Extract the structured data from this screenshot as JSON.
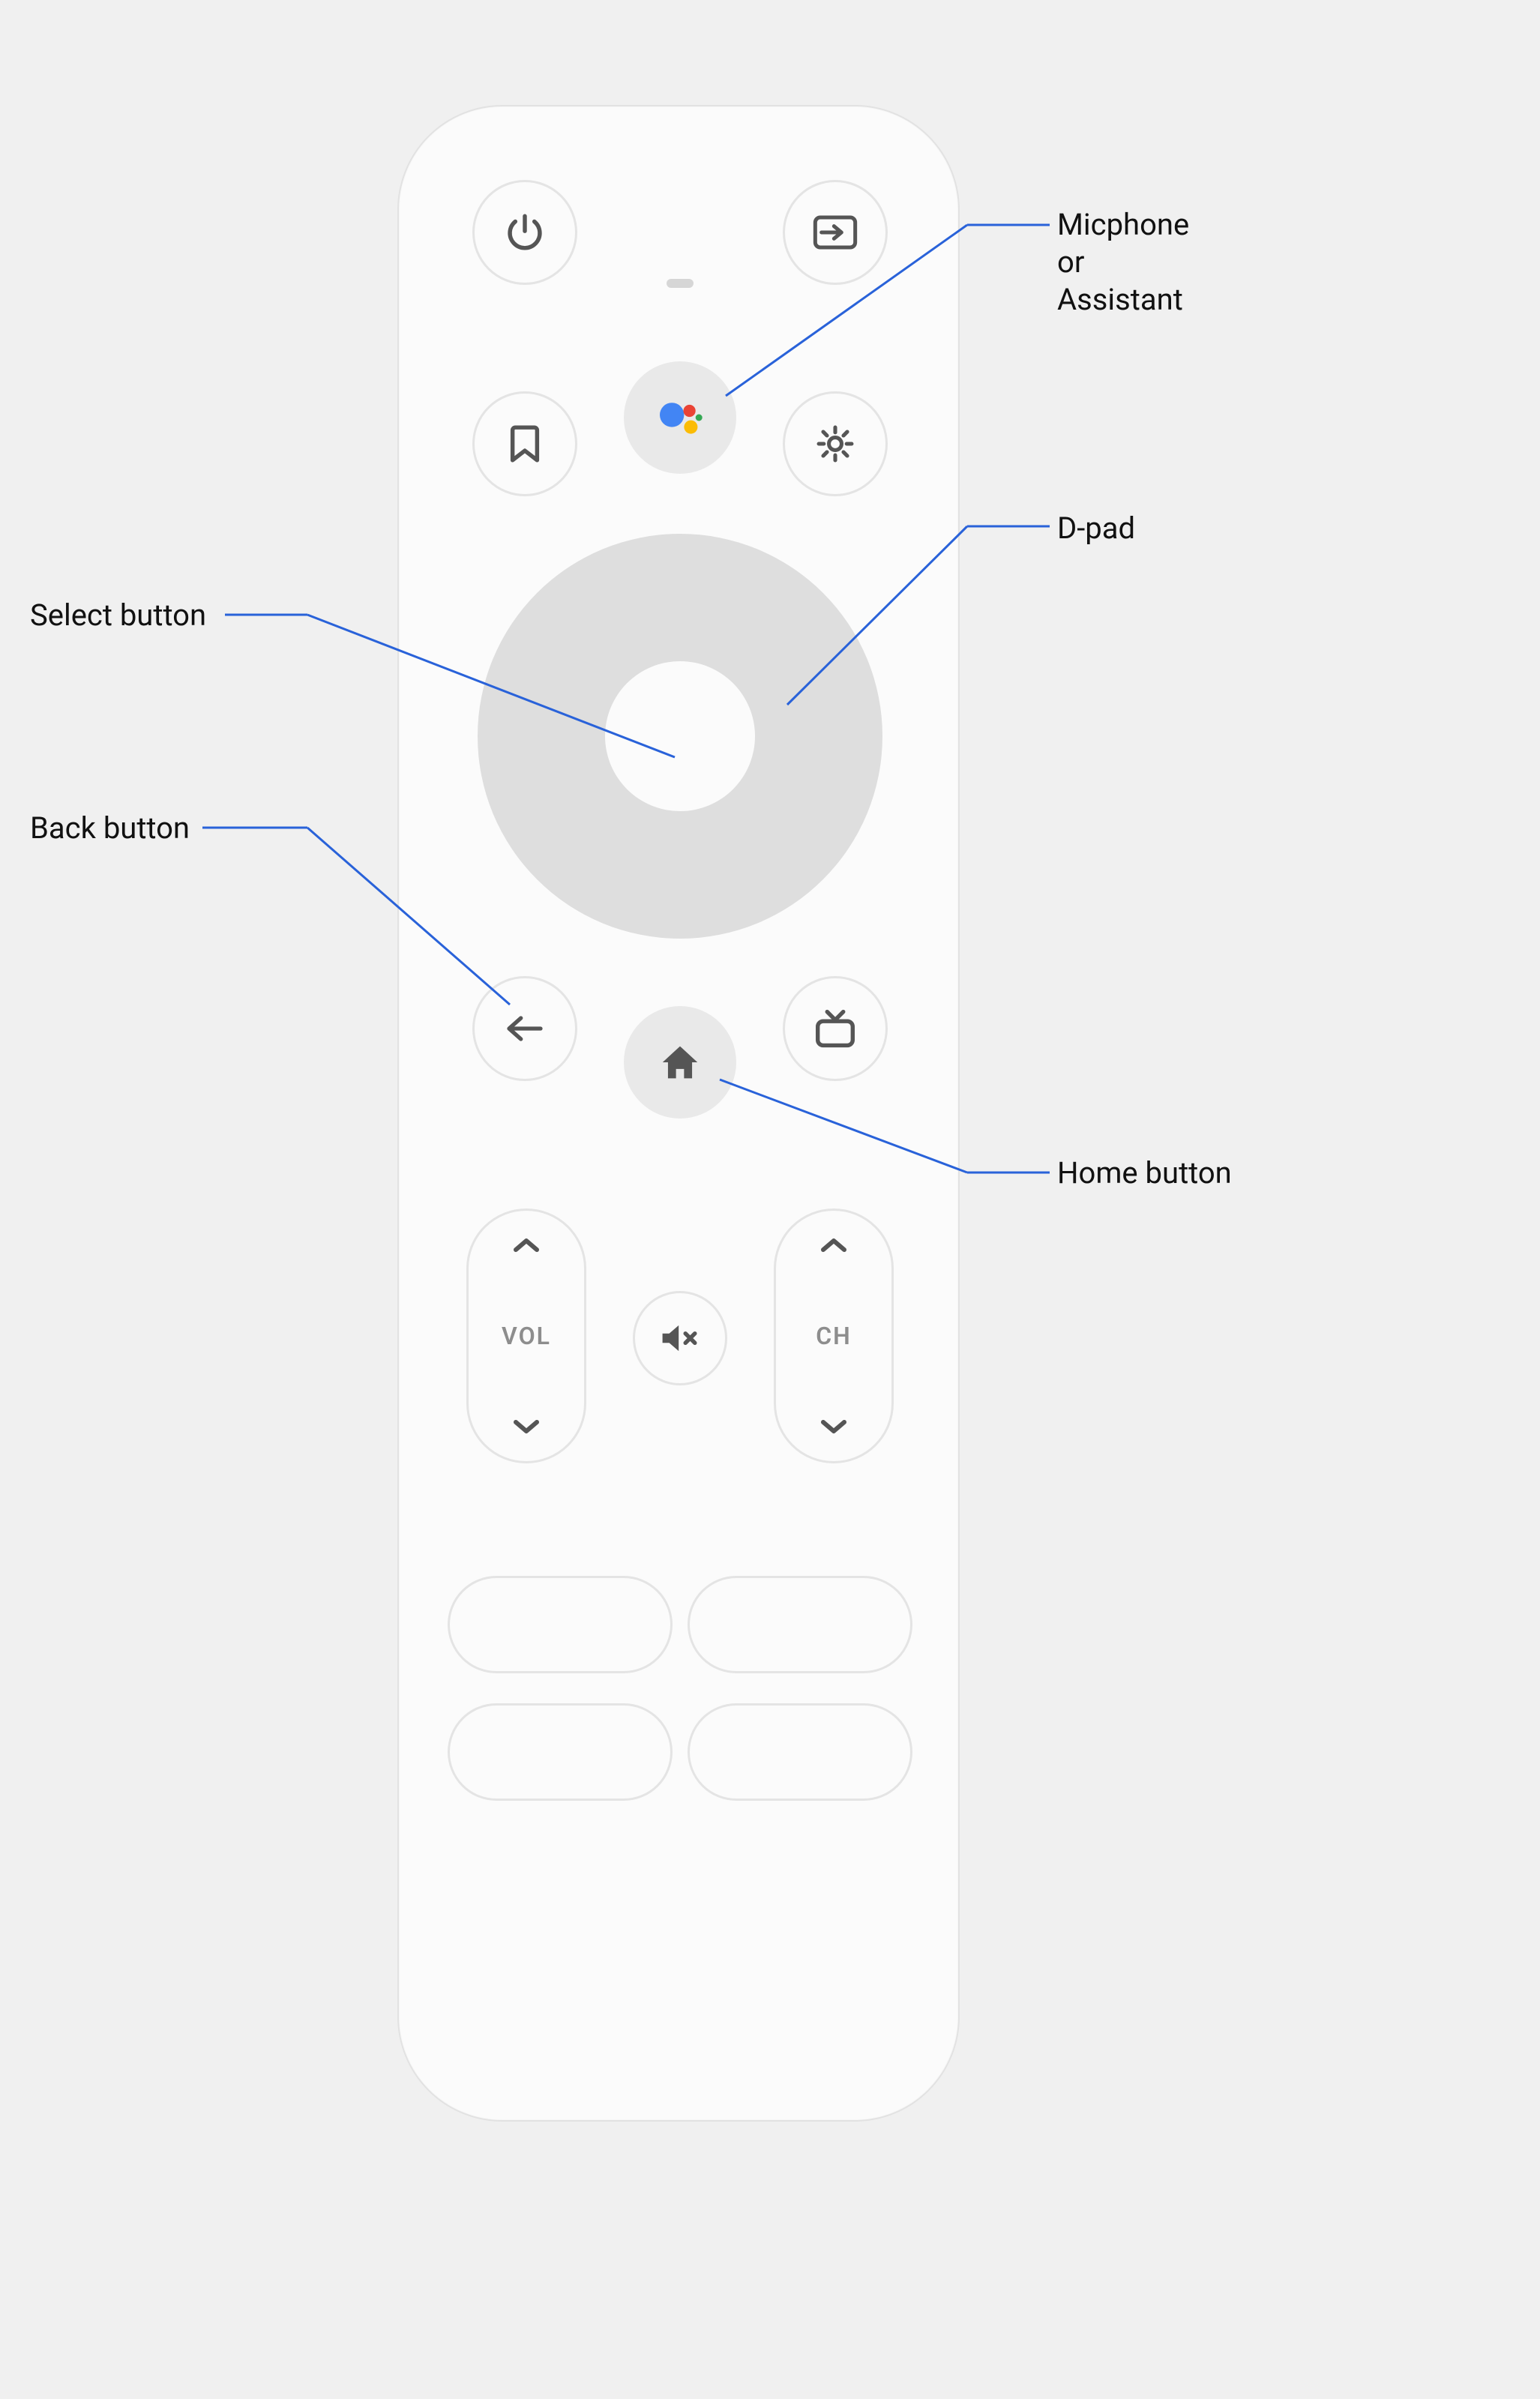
{
  "annotations": {
    "microphone": "Micphone\nor\nAssistant",
    "dpad": "D-pad",
    "select": "Select button",
    "back": "Back button",
    "home": "Home button"
  },
  "rockers": {
    "volume": "VOL",
    "channel": "CH"
  },
  "icons": {
    "power": "power-icon",
    "input": "input-icon",
    "bookmark": "bookmark-icon",
    "assistant": "assistant-icon",
    "settings": "gear-icon",
    "back": "back-arrow-icon",
    "home": "home-icon",
    "tv": "tv-icon",
    "mute": "mute-icon"
  },
  "colors": {
    "assistant_blue": "#4285F4",
    "assistant_red": "#EA4335",
    "assistant_yellow": "#FBBC05",
    "assistant_green": "#34A853",
    "leader": "#2962d9"
  }
}
